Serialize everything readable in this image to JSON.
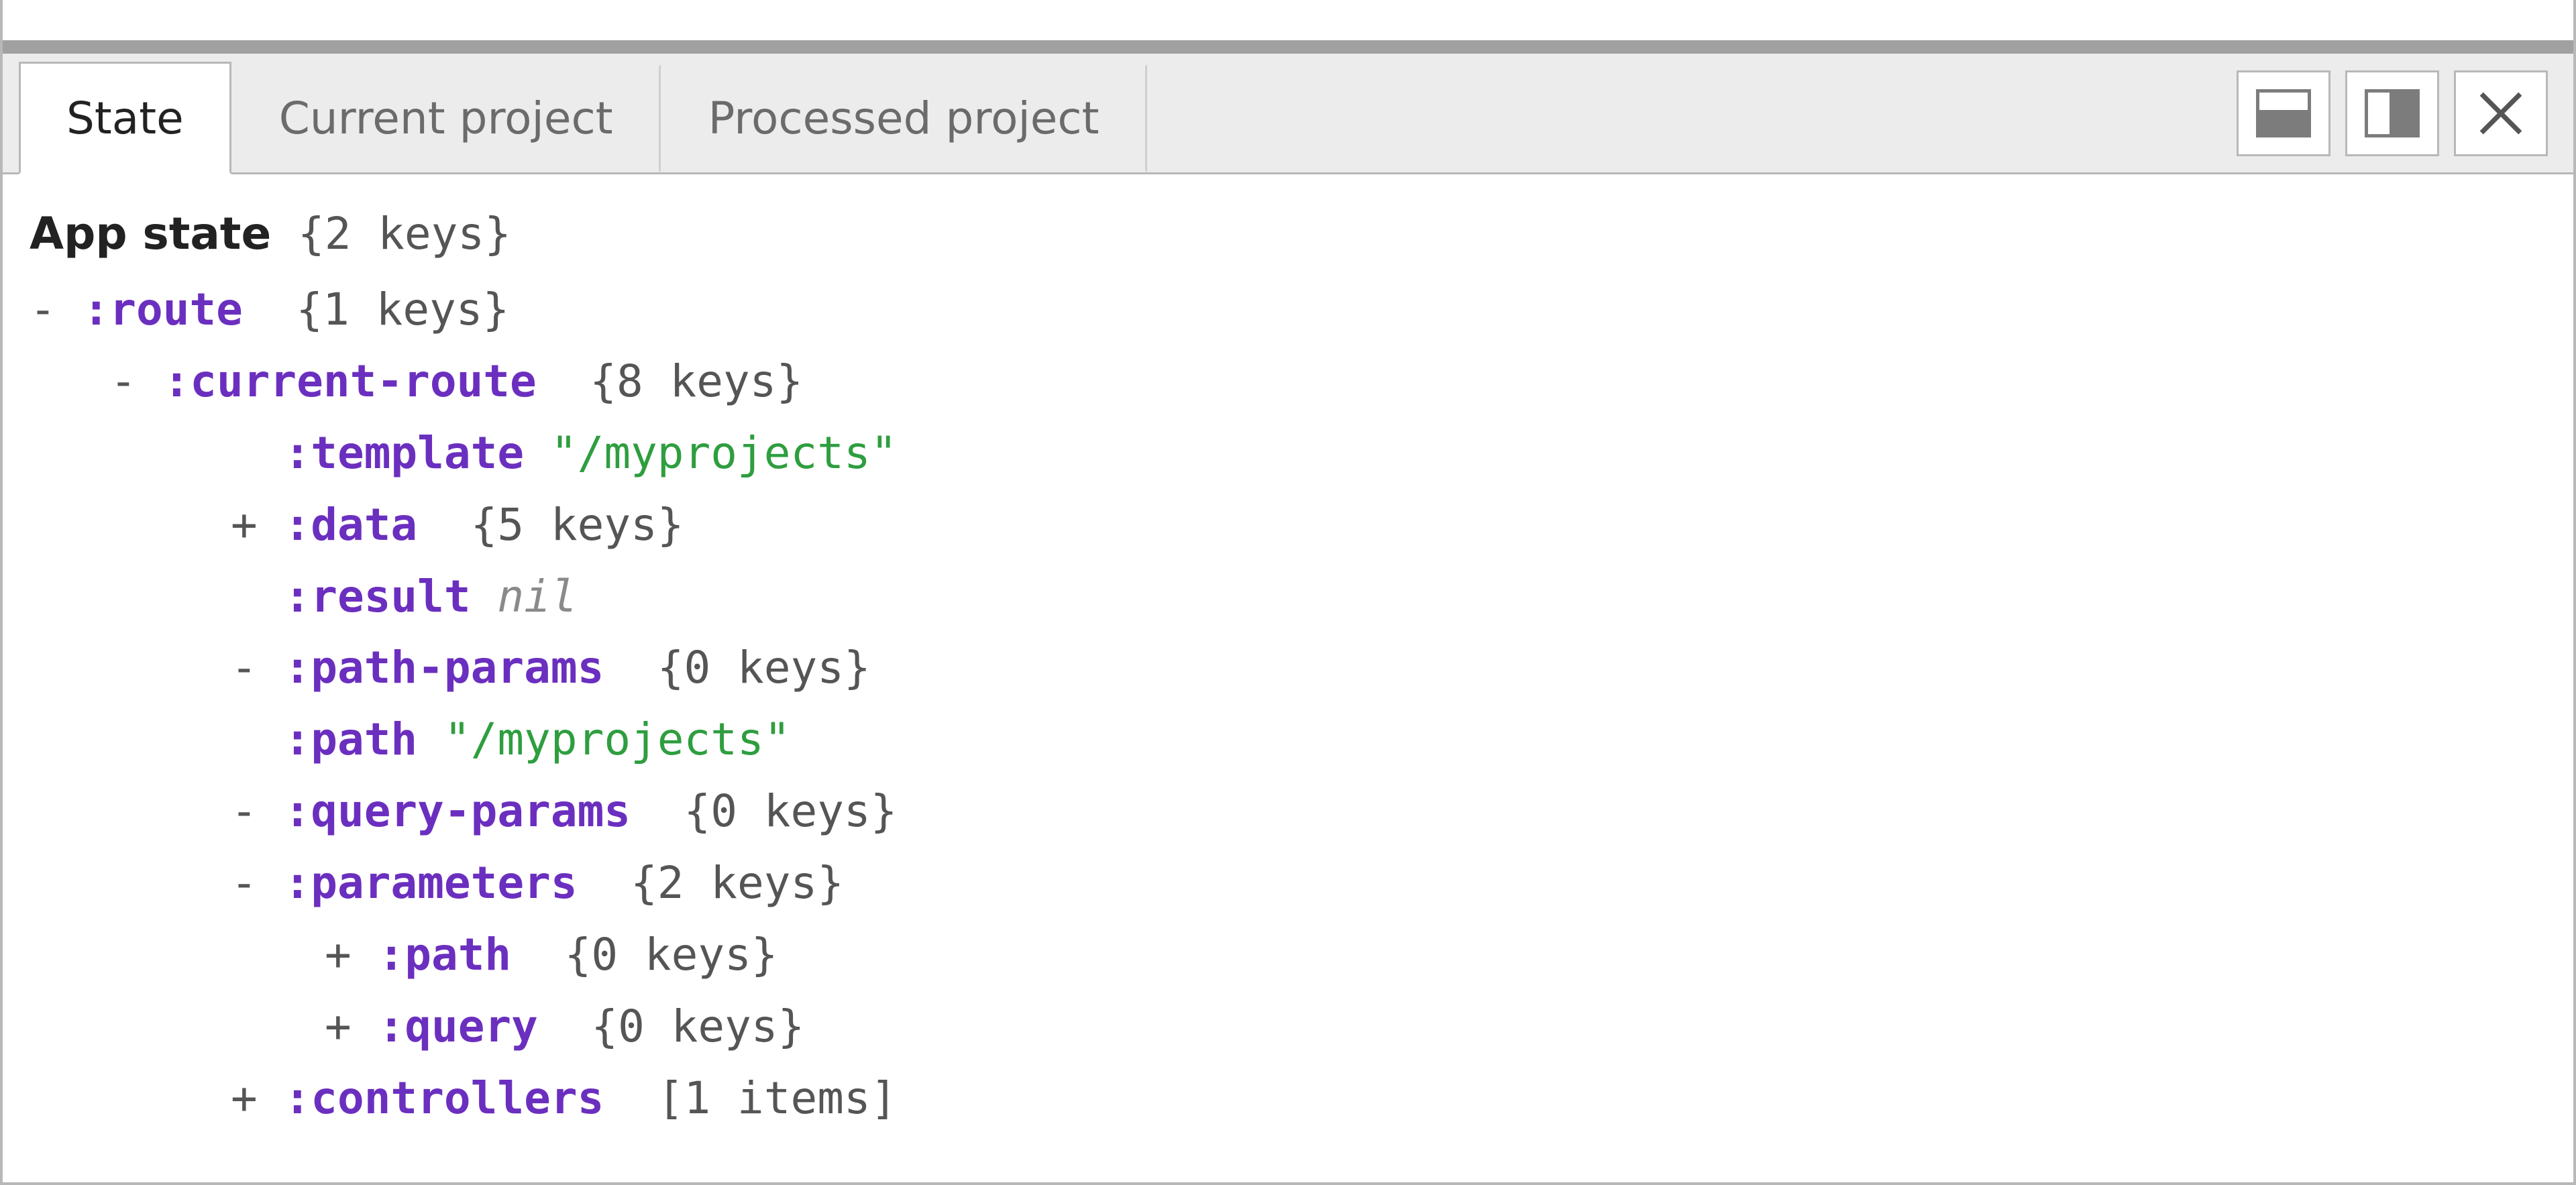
{
  "tabs": {
    "state": "State",
    "current_project": "Current project",
    "processed_project": "Processed project"
  },
  "toolbar": {
    "dock_bottom_tooltip": "Dock to bottom",
    "dock_right_tooltip": "Dock to right",
    "close_tooltip": "Close"
  },
  "tree": {
    "title": "App state",
    "title_summary": "{2 keys}",
    "route": {
      "toggle": "-",
      "key": ":route",
      "summary": "{1 keys}"
    },
    "current_route": {
      "toggle": "-",
      "key": ":current-route",
      "summary": "{8 keys}"
    },
    "template": {
      "key": ":template",
      "value": "\"/myprojects\""
    },
    "data": {
      "toggle": "+",
      "key": ":data",
      "summary": "{5 keys}"
    },
    "result": {
      "key": ":result",
      "value": "nil"
    },
    "path_params": {
      "toggle": "-",
      "key": ":path-params",
      "summary": "{0 keys}"
    },
    "path": {
      "key": ":path",
      "value": "\"/myprojects\""
    },
    "query_params": {
      "toggle": "-",
      "key": ":query-params",
      "summary": "{0 keys}"
    },
    "parameters": {
      "toggle": "-",
      "key": ":parameters",
      "summary": "{2 keys}"
    },
    "param_path": {
      "toggle": "+",
      "key": ":path",
      "summary": "{0 keys}"
    },
    "param_query": {
      "toggle": "+",
      "key": ":query",
      "summary": "{0 keys}"
    },
    "controllers": {
      "toggle": "+",
      "key": ":controllers",
      "summary": "[1 items]"
    }
  }
}
